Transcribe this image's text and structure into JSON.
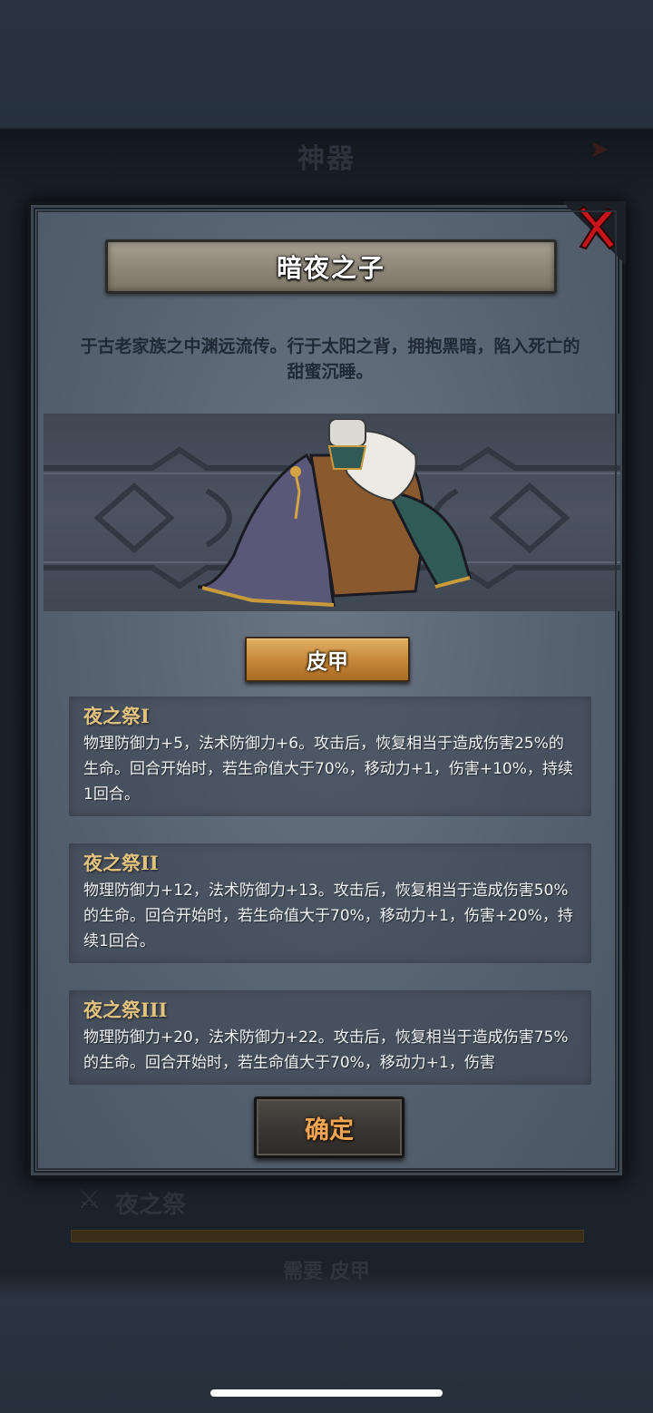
{
  "background": {
    "title": "神器",
    "skill_label": "夜之祭",
    "need_text": "需要 皮甲"
  },
  "dialog": {
    "title": "暗夜之子",
    "description": "于古老家族之中渊远流传。行于太阳之背，拥抱黑暗，陷入死亡的甜蜜沉睡。",
    "item_type": "皮甲",
    "confirm_label": "确定",
    "skills": [
      {
        "name": "夜之祭I",
        "description": "物理防御力+5，法术防御力+6。攻击后，恢复相当于造成伤害25%的生命。回合开始时，若生命值大于70%，移动力+1，伤害+10%，持续1回合。"
      },
      {
        "name": "夜之祭II",
        "description": "物理防御力+12，法术防御力+13。攻击后，恢复相当于造成伤害50%的生命。回合开始时，若生命值大于70%，移动力+1，伤害+20%，持续1回合。"
      },
      {
        "name": "夜之祭III",
        "description": "物理防御力+20，法术防御力+22。攻击后，恢复相当于造成伤害75%的生命。回合开始时，若生命值大于70%，移动力+1，伤害"
      }
    ]
  },
  "icons": {
    "close": "close-x-icon",
    "item": "leather-armor-icon"
  },
  "colors": {
    "accent_gold": "#c88a3b",
    "skill_name": "#e2c27f",
    "close_red": "#c8141a",
    "confirm_text": "#f0a552"
  }
}
